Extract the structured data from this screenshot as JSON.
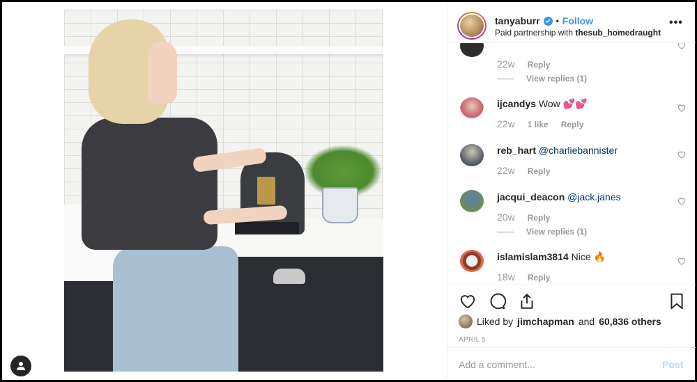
{
  "header": {
    "username": "tanyaburr",
    "separator": "•",
    "follow_label": "Follow",
    "partnership_prefix": "Paid partnership with",
    "partner": "thesub_homedraught",
    "more_icon": "more-horizontal-icon"
  },
  "comments": [
    {
      "username": "",
      "text": "",
      "age": "22w",
      "likes": "",
      "reply_label": "Reply",
      "view_replies": "View replies (1)"
    },
    {
      "username": "ijcandys",
      "text": "Wow 💕💕",
      "mention": "",
      "age": "22w",
      "likes": "1 like",
      "reply_label": "Reply"
    },
    {
      "username": "reb_hart",
      "text": "",
      "mention": "@charliebannister",
      "age": "22w",
      "likes": "",
      "reply_label": "Reply"
    },
    {
      "username": "jacqui_deacon",
      "text": "",
      "mention": "@jack.janes",
      "age": "20w",
      "likes": "",
      "reply_label": "Reply",
      "view_replies": "View replies (1)"
    },
    {
      "username": "islamislam3814",
      "text": "Nice 🔥",
      "mention": "",
      "age": "18w",
      "likes": "",
      "reply_label": "Reply"
    }
  ],
  "actions": {
    "like_icon": "heart-icon",
    "comment_icon": "comment-icon",
    "share_icon": "share-icon",
    "save_icon": "bookmark-icon"
  },
  "likes": {
    "prefix": "Liked by",
    "user": "jimchapman",
    "middle": "and",
    "others": "60,836 others"
  },
  "date": "APRIL 5",
  "add_comment": {
    "placeholder": "Add a comment...",
    "post_label": "Post"
  },
  "colors": {
    "accent": "#3897f0",
    "post_disabled": "#b2dffc",
    "muted": "#999999"
  }
}
